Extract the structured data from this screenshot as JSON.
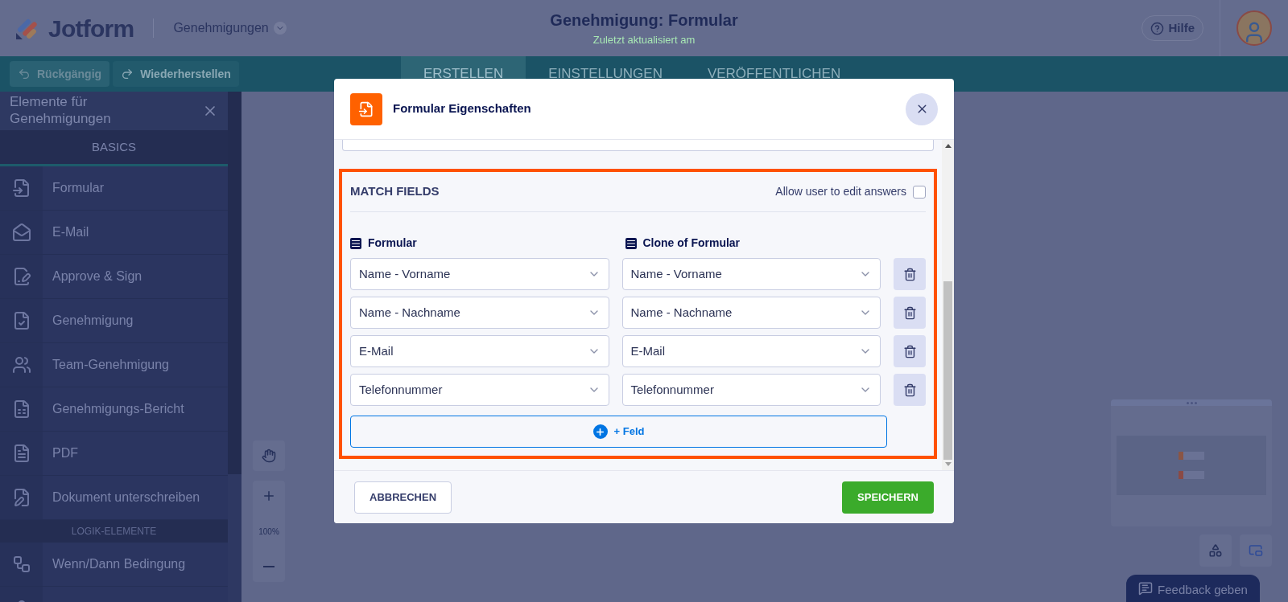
{
  "header": {
    "logo": "Jotform",
    "workspace": "Genehmigungen",
    "title": "Genehmigung: Formular",
    "subtitle": "Zuletzt aktualisiert am",
    "help": "Hilfe"
  },
  "toolbar": {
    "undo": "Rückgängig",
    "redo": "Wiederherstellen",
    "tabs": [
      {
        "label": "ERSTELLEN",
        "selected": true
      },
      {
        "label": "EINSTELLUNGEN",
        "selected": false
      },
      {
        "label": "VERÖFFENTLICHEN",
        "selected": false
      }
    ]
  },
  "sidebar": {
    "title": "Elemente für Genehmigungen",
    "section": "BASICS",
    "items": [
      {
        "label": "Formular"
      },
      {
        "label": "E-Mail"
      },
      {
        "label": "Approve & Sign"
      },
      {
        "label": "Genehmigung"
      },
      {
        "label": "Team-Genehmigung"
      },
      {
        "label": "Genehmigungs-Bericht"
      },
      {
        "label": "PDF"
      },
      {
        "label": "Dokument unterschreiben"
      }
    ],
    "logic_section": "LOGIK-ELEMENTE",
    "logic_items": [
      {
        "label": "Wenn/Dann Bedingung"
      }
    ]
  },
  "zoom": {
    "level_text": "100%"
  },
  "modal": {
    "title": "Formular Eigenschaften",
    "section_title": "MATCH FIELDS",
    "allow_edit": {
      "label": "Allow user to edit answers",
      "checked": false
    },
    "left_column": "Formular",
    "right_column": "Clone of Formular",
    "rows": [
      {
        "left": "Name - Vorname",
        "right": "Name - Vorname"
      },
      {
        "left": "Name - Nachname",
        "right": "Name - Nachname"
      },
      {
        "left": "E-Mail",
        "right": "E-Mail"
      },
      {
        "left": "Telefonnummer",
        "right": "Telefonnummer"
      }
    ],
    "add_button": "+ Feld",
    "cancel": "ABBRECHEN",
    "save": "SPEICHERN"
  },
  "feedback": "Feedback geben"
}
